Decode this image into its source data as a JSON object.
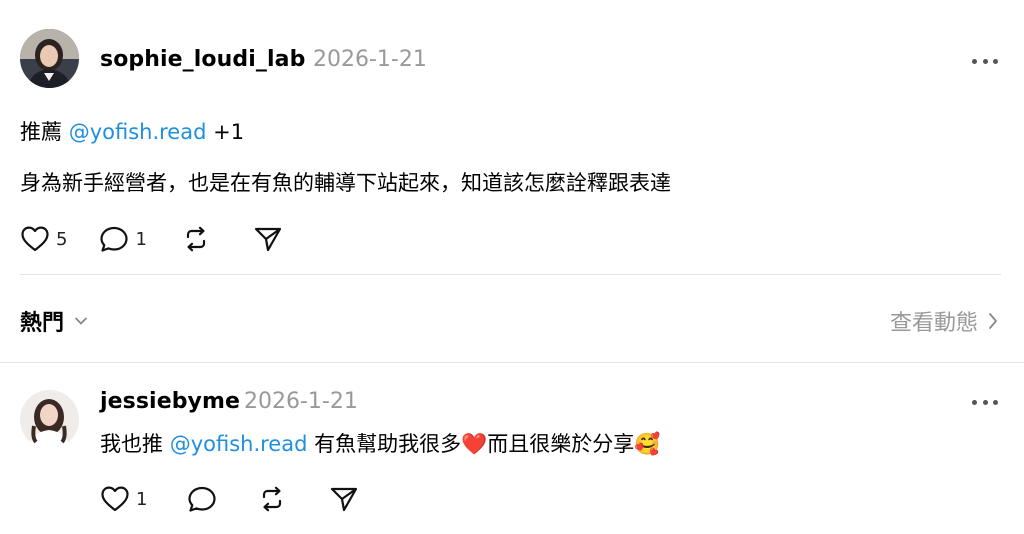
{
  "post": {
    "username": "sophie_loudi_lab",
    "date": "2026-1-21",
    "line1_prefix": "推薦 ",
    "line1_mention": "@yofish.read",
    "line1_suffix": " +1",
    "line2": "身為新手經營者，也是在有魚的輔導下站起來，知道該怎麼詮釋跟表達",
    "likes": "5",
    "replies": "1"
  },
  "replies_bar": {
    "sort_label": "熱門",
    "activity_label": "查看動態"
  },
  "reply": {
    "username": "jessiebyme",
    "date": "2026-1-21",
    "text_prefix": "我也推 ",
    "mention": "@yofish.read",
    "text_middle": " 有魚幫助我很多",
    "heart_emoji": "❤️",
    "text_after_heart": "而且很樂於分享",
    "smile_emoji": "🥰",
    "likes": "1"
  },
  "icons": {
    "like": "heart-icon",
    "reply": "comment-icon",
    "repost": "repost-icon",
    "share": "send-icon",
    "more": "more-icon",
    "chevron_down": "chevron-down-icon",
    "chevron_right": "chevron-right-icon"
  },
  "colors": {
    "mention": "#1f8fe0",
    "secondary_text": "#999999",
    "divider": "#e4e4e4"
  }
}
